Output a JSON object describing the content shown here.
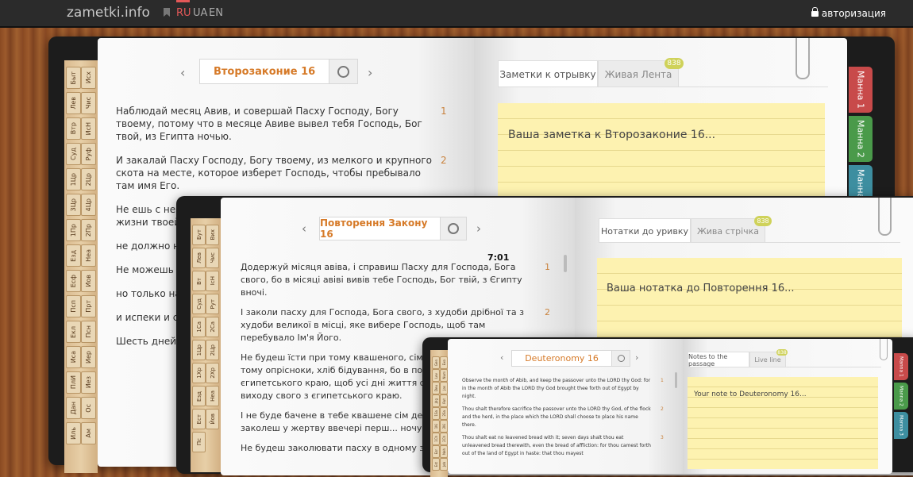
{
  "header": {
    "logo": "zametki.info",
    "langs": [
      "RU",
      "UA",
      "EN"
    ],
    "auth": "авторизация"
  },
  "time": "7:01",
  "book1": {
    "abbrs": [
      "Быт",
      "Исх",
      "Лев",
      "Чис",
      "Втр",
      "ИсН",
      "Суд",
      "Руф",
      "1Цр",
      "2Цр",
      "3Цр",
      "4Цр",
      "1Пр",
      "2Пр",
      "Езд",
      "Неа",
      "Есф",
      "Иов",
      "Псп",
      "Прт",
      "Екл",
      "Псн",
      "Иса",
      "Иер",
      "ПлИ",
      "Иез",
      "Дан",
      "Ос",
      "Иль",
      "Ам"
    ],
    "search": "Второзаконие 16",
    "verses": [
      {
        "n": "1",
        "text": "Наблюдай месяц Авив, и совершай Пасху Господу, Богу твоему, потому что в месяце Авиве вывел тебя Господь, Бог твой, из Египта ночью."
      },
      {
        "n": "2",
        "text": "И закалай Пасху Господу, Богу твоему, из мелкого и крупного скота на месте, которое изберет Господь, чтобы пребывало там имя Его."
      },
      {
        "n": "",
        "text": "Не ешь с нею квасного... бедствия, ибо... ты помнил де... жизни твоей;"
      },
      {
        "n": "",
        "text": "не должно на... продолжение... вечером в пе..."
      },
      {
        "n": "",
        "text": "Не можешь т... которые Госп..."
      },
      {
        "n": "",
        "text": "но только на... пребывало та... солнца, в то с..."
      },
      {
        "n": "",
        "text": "и испеки и съ... твой, а на дру..."
      },
      {
        "n": "",
        "text": "Шесть дней е... праздника Го..."
      }
    ],
    "tabs": [
      {
        "label": "Заметки к отрывку"
      },
      {
        "label": "Живая Лента"
      }
    ],
    "badge": "838",
    "note": "Ваша заметка к Второзаконие 16...",
    "side": [
      "Манна 1",
      "Манна 2",
      "Манна 3"
    ]
  },
  "book2": {
    "abbrs": [
      "Бут",
      "Вих",
      "Лев",
      "Чис",
      "Вт",
      "ІсН",
      "Суд",
      "Рут",
      "1Са",
      "2Са",
      "1Цр",
      "2Цр",
      "1Хр",
      "2Хр",
      "Езд",
      "Неа",
      "Ест",
      "Йов",
      "Пс"
    ],
    "search": "Повторення Закону 16",
    "verses": [
      {
        "n": "1",
        "text": "Додержуй місяця авіва, і справиш Пасху для Господа, Бога свого, бо в місяці авіві вивів тебе Господь, Бог твій, з Єгипту вночі."
      },
      {
        "n": "2",
        "text": "І заколи пасху для Господа, Бога свого, з худоби дрібної та з худоби великої в місці, яке вибере Господь, щоб там перебувало Ім'я Його."
      },
      {
        "n": "3",
        "text": "Не будеш їсти при тому квашеного, сім день будеш їсти при тому опрісноки, хліб бідування, бо в поспіху вийшов ти з єгипетського краю, щоб усі дні життя свого пам'ятати день виходу свого з єгипетського краю."
      },
      {
        "n": "",
        "text": "І не буде бачене в тебе квашене сім день у... м'ясза, що заколеш у жертву ввечері перш... ночувати до ранку."
      },
      {
        "n": "",
        "text": "Не будеш заколювати пасху в одному з тв... Бог твій дає тобі."
      }
    ],
    "tabs": [
      {
        "label": "Нотатки до уривку"
      },
      {
        "label": "Жива стрічка"
      }
    ],
    "badge": "838",
    "note": "Ваша нотатка до Повторення 16..."
  },
  "book3": {
    "abbrs": [
      "Gen",
      "Exo",
      "Lev",
      "Num",
      "Deu",
      "Jos",
      "Jdg",
      "Rut",
      "1Sa",
      "2Sa",
      "1Ki",
      "2Ki",
      "1Ch",
      "2Ch",
      "Ezr",
      "Neh",
      "Est",
      "Job"
    ],
    "search": "Deuteronomy 16",
    "verses": [
      {
        "n": "1",
        "text": "Observe the month of Abib, and keep the passover unto the LORD thy God: for in the month of Abib the LORD thy God brought thee forth out of Egypt by night."
      },
      {
        "n": "2",
        "text": "Thou shalt therefore sacrifice the passover unto the LORD thy God, of the flock and the herd, in the place which the LORD shall choose to place his name there."
      },
      {
        "n": "3",
        "text": "Thou shalt eat no leavened bread with it; seven days shalt thou eat unleavened bread therewith, even the bread of affliction: for thou camest forth out of the land of Egypt in haste: that thou mayest"
      }
    ],
    "tabs": [
      {
        "label": "Notes to the passage"
      },
      {
        "label": "Live line"
      }
    ],
    "badge": "838",
    "note": "Your note to Deuteronomy 16...",
    "side": [
      "Manna 1",
      "Manna 2",
      "Manna 3"
    ]
  },
  "colors": {
    "accent": "#d67a28",
    "manna1": "#c84a4a",
    "manna2": "#4a9a4a",
    "manna3": "#3d8ea0"
  }
}
